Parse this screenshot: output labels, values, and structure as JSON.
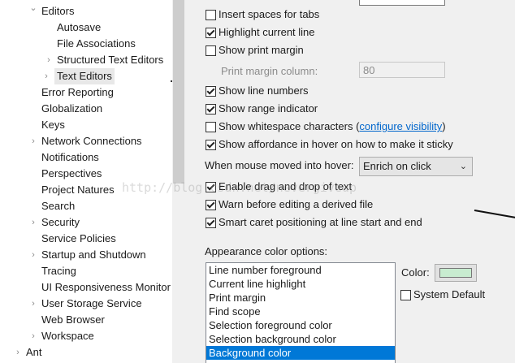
{
  "tree": {
    "items": [
      {
        "label": "Editors",
        "twisty": "expanded"
      },
      {
        "label": "Autosave",
        "twisty": ""
      },
      {
        "label": "File Associations",
        "twisty": ""
      },
      {
        "label": "Structured Text Editors",
        "twisty": "collapsed"
      },
      {
        "label": "Text Editors",
        "twisty": "collapsed"
      },
      {
        "label": "Error Reporting",
        "twisty": ""
      },
      {
        "label": "Globalization",
        "twisty": ""
      },
      {
        "label": "Keys",
        "twisty": ""
      },
      {
        "label": "Network Connections",
        "twisty": "collapsed"
      },
      {
        "label": "Notifications",
        "twisty": ""
      },
      {
        "label": "Perspectives",
        "twisty": ""
      },
      {
        "label": "Project Natures",
        "twisty": ""
      },
      {
        "label": "Search",
        "twisty": ""
      },
      {
        "label": "Security",
        "twisty": "collapsed"
      },
      {
        "label": "Service Policies",
        "twisty": ""
      },
      {
        "label": "Startup and Shutdown",
        "twisty": "collapsed"
      },
      {
        "label": "Tracing",
        "twisty": ""
      },
      {
        "label": "UI Responsiveness Monitor",
        "twisty": ""
      },
      {
        "label": "User Storage Service",
        "twisty": "collapsed"
      },
      {
        "label": "Web Browser",
        "twisty": ""
      },
      {
        "label": "Workspace",
        "twisty": "collapsed"
      },
      {
        "label": "Ant",
        "twisty": "collapsed"
      }
    ],
    "selected": "Text Editors"
  },
  "options": {
    "insert_spaces": {
      "label": "Insert spaces for tabs",
      "checked": false
    },
    "highlight_line": {
      "label": "Highlight current line",
      "checked": true
    },
    "print_margin": {
      "label": "Show print margin",
      "checked": false
    },
    "print_margin_column": {
      "label": "Print margin column:",
      "value": "80"
    },
    "line_numbers": {
      "label": "Show line numbers",
      "checked": true
    },
    "range_indicator": {
      "label": "Show range indicator",
      "checked": true
    },
    "whitespace": {
      "label": "Show whitespace characters (",
      "link": "configure visibility",
      "suffix": ")",
      "checked": false
    },
    "affordance": {
      "label": "Show affordance in hover on how to make it sticky",
      "checked": true
    },
    "hover": {
      "label": "When mouse moved into hover:",
      "value": "Enrich on click"
    },
    "drag_drop": {
      "label": "Enable drag and drop of text",
      "checked": true
    },
    "warn_derived": {
      "label": "Warn before editing a derived file",
      "checked": true
    },
    "smart_caret": {
      "label": "Smart caret positioning at line start and end",
      "checked": true
    }
  },
  "appearance": {
    "title": "Appearance color options:",
    "items": [
      "Line number foreground",
      "Current line highlight",
      "Print margin",
      "Find scope",
      "Selection foreground color",
      "Selection background color",
      "Background color"
    ],
    "selected_index": 6,
    "color_label": "Color:",
    "color_value": "#c8ecd0",
    "system_default": {
      "label": "System Default",
      "checked": false
    }
  },
  "watermark": "http://blog.csdn.net/nevergiveup",
  "colors": {
    "selection": "#0078d7",
    "link": "#0066cc",
    "pane_bg": "#f0f0f0"
  }
}
